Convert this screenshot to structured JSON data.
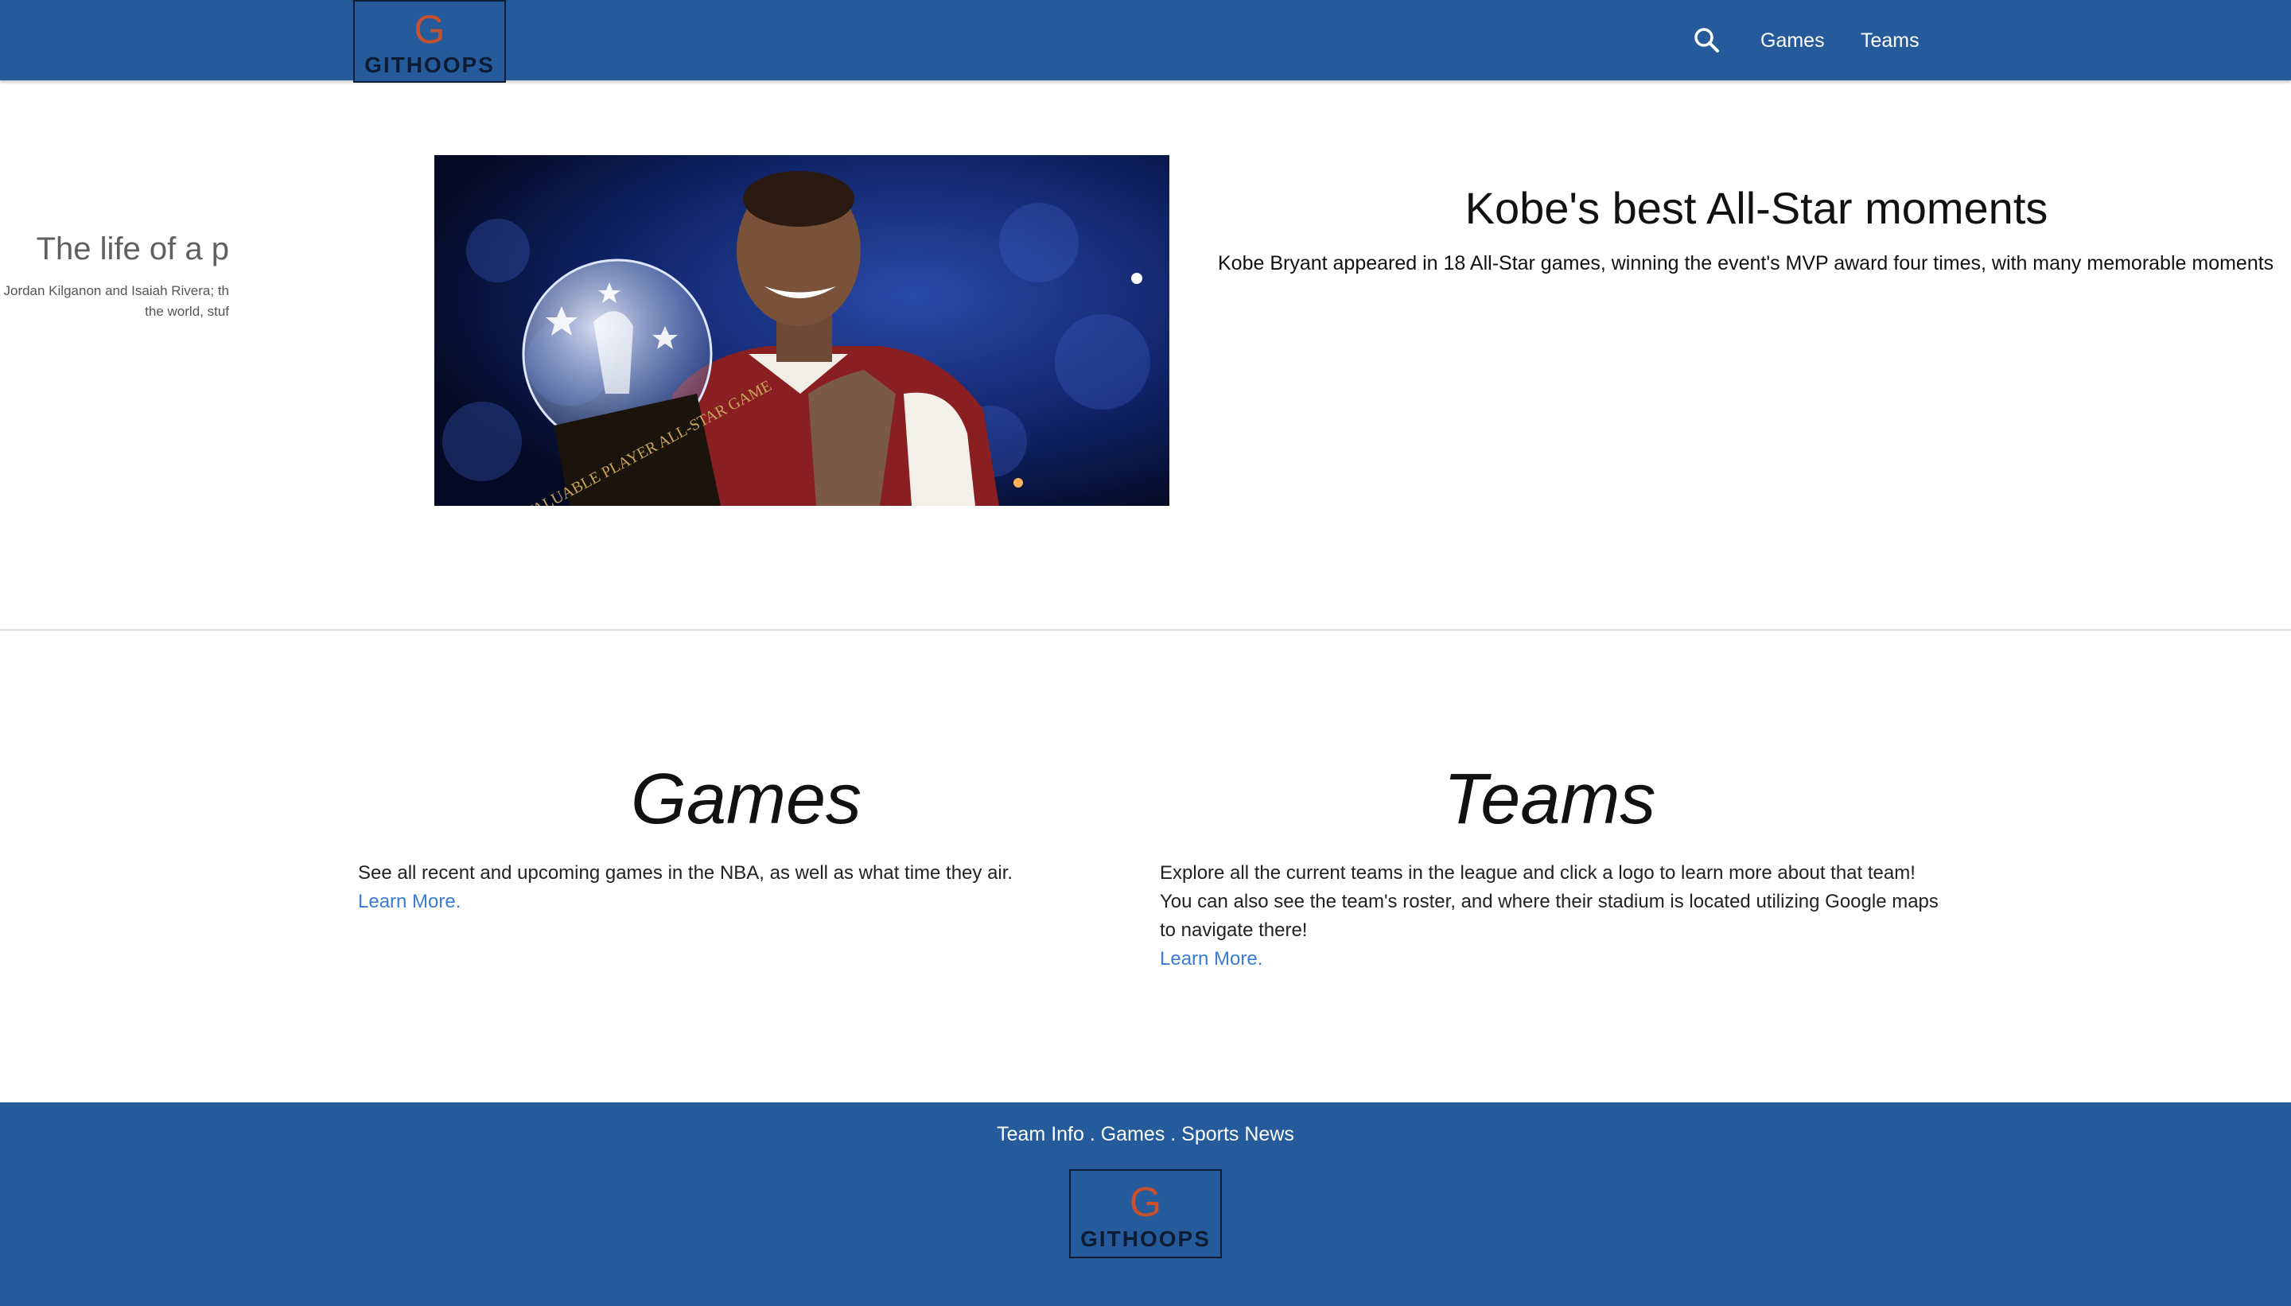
{
  "header": {
    "logo": {
      "letter": "G",
      "wordmark": "GITHOOPS"
    },
    "search_icon": "search-icon",
    "nav": [
      {
        "label": "Games"
      },
      {
        "label": "Teams"
      }
    ]
  },
  "carousel": {
    "previous_slide": {
      "title": "The life of a p",
      "text_line1": "Jordan Kilganon and Isaiah Rivera; th",
      "text_line2": "the world, stuf"
    },
    "current_slide": {
      "image_alt": "Kobe Bryant holding the All-Star MVP trophy",
      "trophy_text": "MOST VALUABLE PLAYER ALL-STAR GAME",
      "title": "Kobe's best All-Star moments",
      "text": "Kobe Bryant appeared in 18 All-Star games, winning the event's MVP award four times, with many memorable moments"
    }
  },
  "features": {
    "games": {
      "heading": "Games",
      "body": "See all recent and upcoming games in the NBA, as well as what time they air.",
      "link": "Learn More."
    },
    "teams": {
      "heading": "Teams",
      "body": "Explore all the current teams in the league and click a logo to learn more about that team! You can also see the team's roster, and where their stadium is located utilizing Google maps to navigate there!",
      "link": "Learn More."
    }
  },
  "footer": {
    "links": [
      "Team Info",
      "Games",
      "Sports News"
    ],
    "separator": " . ",
    "logo": {
      "letter": "G",
      "wordmark": "GITHOOPS"
    }
  },
  "colors": {
    "brand_blue": "#255b9b",
    "logo_orange": "#c9502e",
    "logo_navy": "#0d1b33",
    "link_blue": "#3a7cd0"
  }
}
